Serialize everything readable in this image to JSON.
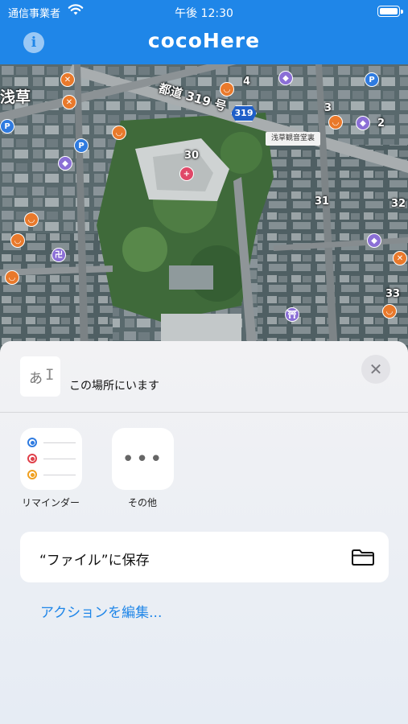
{
  "status_bar": {
    "carrier": "通信事業者",
    "time": "午後 12:30"
  },
  "header": {
    "title": "cocoHere"
  },
  "map": {
    "district_label": "浅草",
    "road_label": "都道 319 号",
    "route_number": "319",
    "station_sign": "浅草観音堂裏",
    "block_numbers": [
      "30",
      "31",
      "32",
      "33",
      "4",
      "3",
      "2"
    ],
    "poi_icons": [
      "parking-icon",
      "cafe-icon",
      "restaurant-icon",
      "temple-icon",
      "hospital-icon",
      "shrine-icon"
    ]
  },
  "share_sheet": {
    "doc_thumbnail_glyph": "あ",
    "doc_title": "この場所にいます",
    "close_glyph": "✕",
    "apps": [
      {
        "label": "リマインダー",
        "icon": "reminders-icon"
      },
      {
        "label": "その他",
        "icon": "more-icon"
      }
    ],
    "more_glyph": "•••",
    "actions": [
      {
        "label": "“ファイル”に保存",
        "icon": "folder-icon"
      }
    ],
    "edit_actions_label": "アクションを編集..."
  },
  "colors": {
    "header_blue": "#1f86e8",
    "link_blue": "#1f86e8",
    "reminder_blue": "#2f7be0",
    "reminder_red": "#e0404a",
    "reminder_orange": "#f0a020"
  }
}
